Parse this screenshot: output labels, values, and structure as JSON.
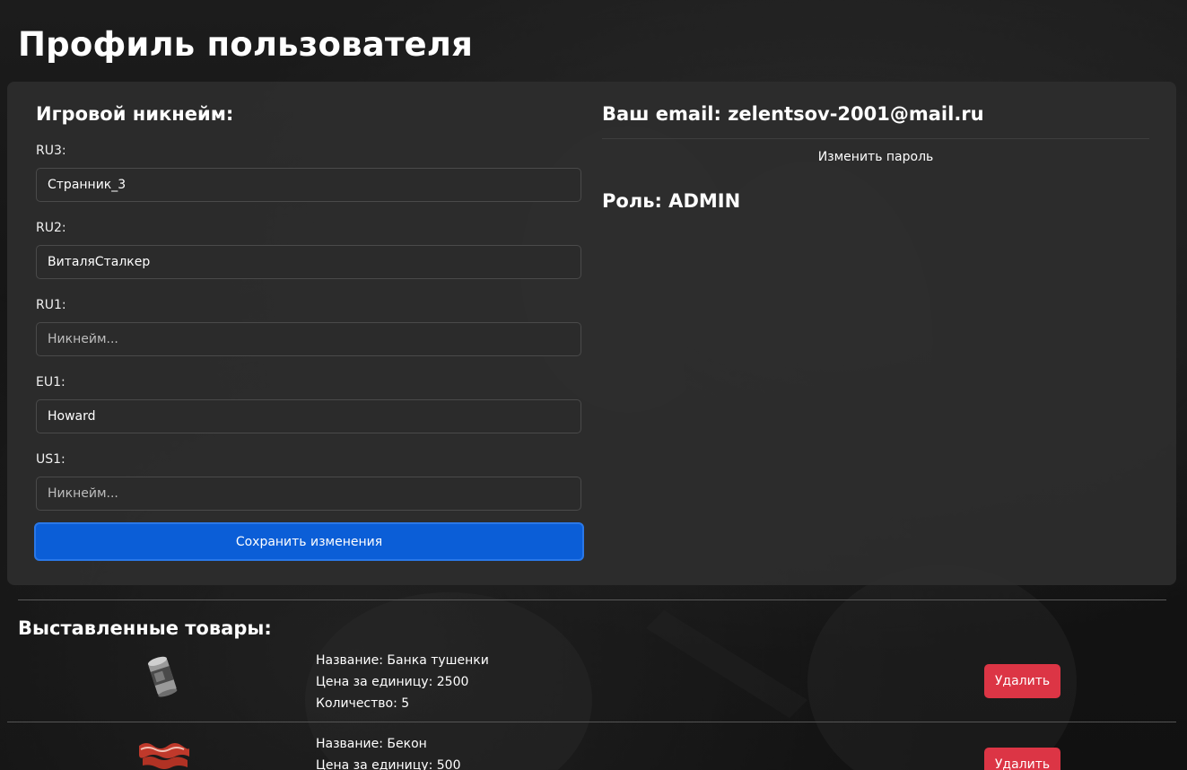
{
  "page": {
    "title": "Профиль пользователя"
  },
  "nicknames": {
    "heading": "Игровой никнейм:",
    "fields": [
      {
        "label": "RU3:",
        "value": "Странник_3",
        "placeholder": "Никнейм..."
      },
      {
        "label": "RU2:",
        "value": "ВиталяСталкер",
        "placeholder": "Никнейм..."
      },
      {
        "label": "RU1:",
        "value": "",
        "placeholder": "Никнейм..."
      },
      {
        "label": "EU1:",
        "value": "Howard",
        "placeholder": "Никнейм..."
      },
      {
        "label": "US1:",
        "value": "",
        "placeholder": "Никнейм..."
      }
    ],
    "save_label": "Сохранить изменения"
  },
  "account": {
    "email_text": "Ваш email: zelentsov-2001@mail.ru",
    "change_password_label": "Изменить пароль",
    "role_text": "Роль: ADMIN"
  },
  "listings": {
    "title": "Выставленные товары:",
    "items": [
      {
        "name": "Название: Банка тушенки",
        "price": "Цена за единицу: 2500",
        "quantity": "Количество: 5",
        "delete_label": "Удалить",
        "icon": "canned-meat-icon"
      },
      {
        "name": "Название: Бекон",
        "price": "Цена за единицу: 500",
        "quantity": "",
        "delete_label": "Удалить",
        "icon": "bacon-icon"
      }
    ]
  },
  "colors": {
    "primary_button": "#0b5ed7",
    "danger_button": "#dc3545",
    "card_background": "#2d2d2d"
  }
}
